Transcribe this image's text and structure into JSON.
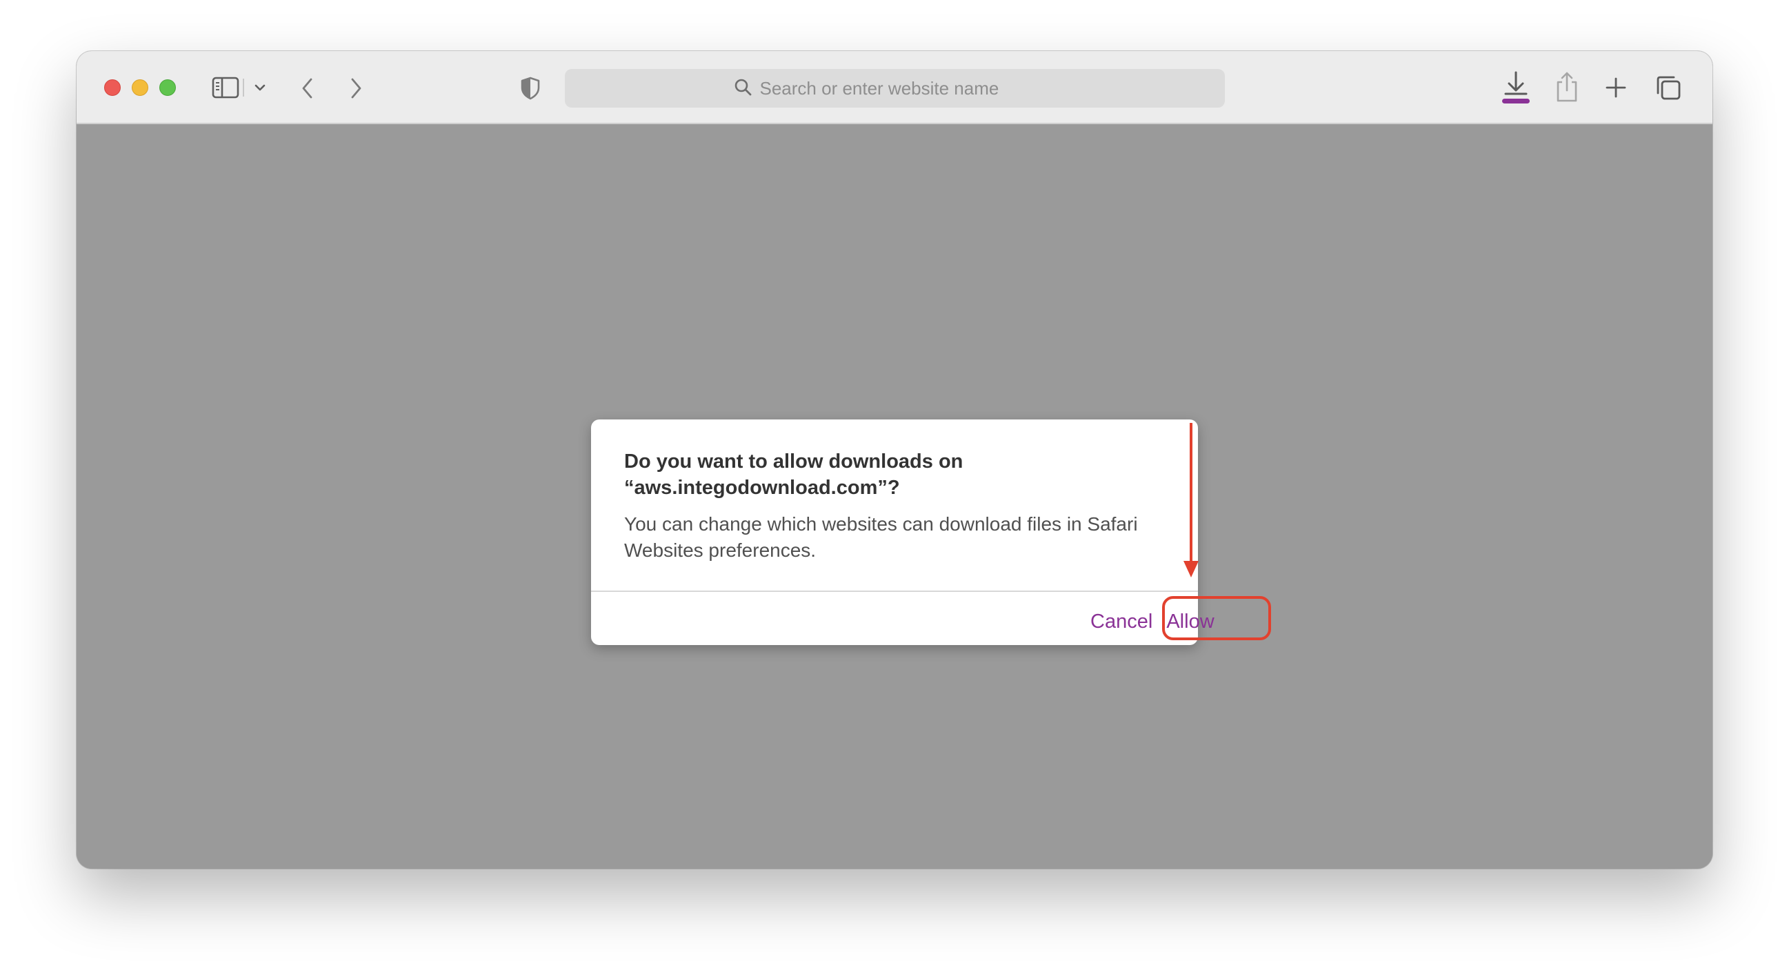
{
  "browser": {
    "address_bar": {
      "placeholder": "Search or enter website name"
    },
    "toolbar_icons": [
      "sidebar-icon",
      "chevron-down-icon",
      "back-icon",
      "forward-icon",
      "privacy-shield-icon",
      "search-icon",
      "download-icon",
      "share-icon",
      "plus-icon",
      "tabs-overview-icon"
    ],
    "accent_color": "#8a3296",
    "download_indicator_color": "#8a3296"
  },
  "dialog": {
    "title": "Do you want to allow downloads on “aws.integodownload.com”?",
    "body": "You can change which websites can download files in Safari Websites preferences.",
    "cancel_label": "Cancel",
    "allow_label": "Allow"
  },
  "annotation": {
    "highlight_color": "#e2412e"
  }
}
